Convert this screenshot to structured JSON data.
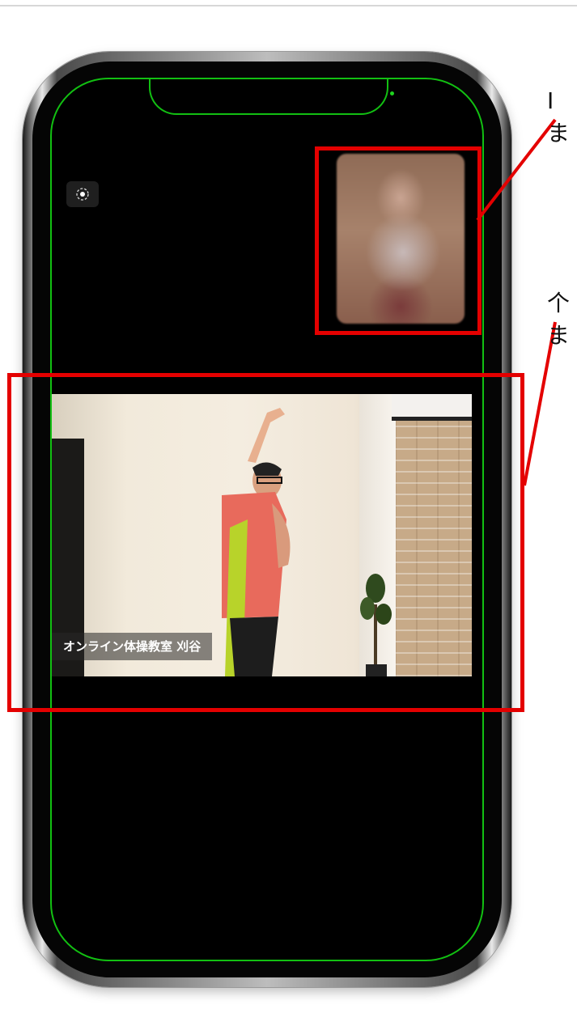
{
  "main_video": {
    "participant_name": "オンライン体操教室 刈谷"
  },
  "annotations": {
    "callout_top_line1": "I",
    "callout_top_line2": "ま",
    "callout_bottom_line1": "个",
    "callout_bottom_line2": "ま"
  },
  "icons": {
    "screenshot": "camera-shutter-icon"
  },
  "colors": {
    "highlight": "#e40000",
    "screen_outline": "#12c012",
    "screen_background": "#000000"
  }
}
